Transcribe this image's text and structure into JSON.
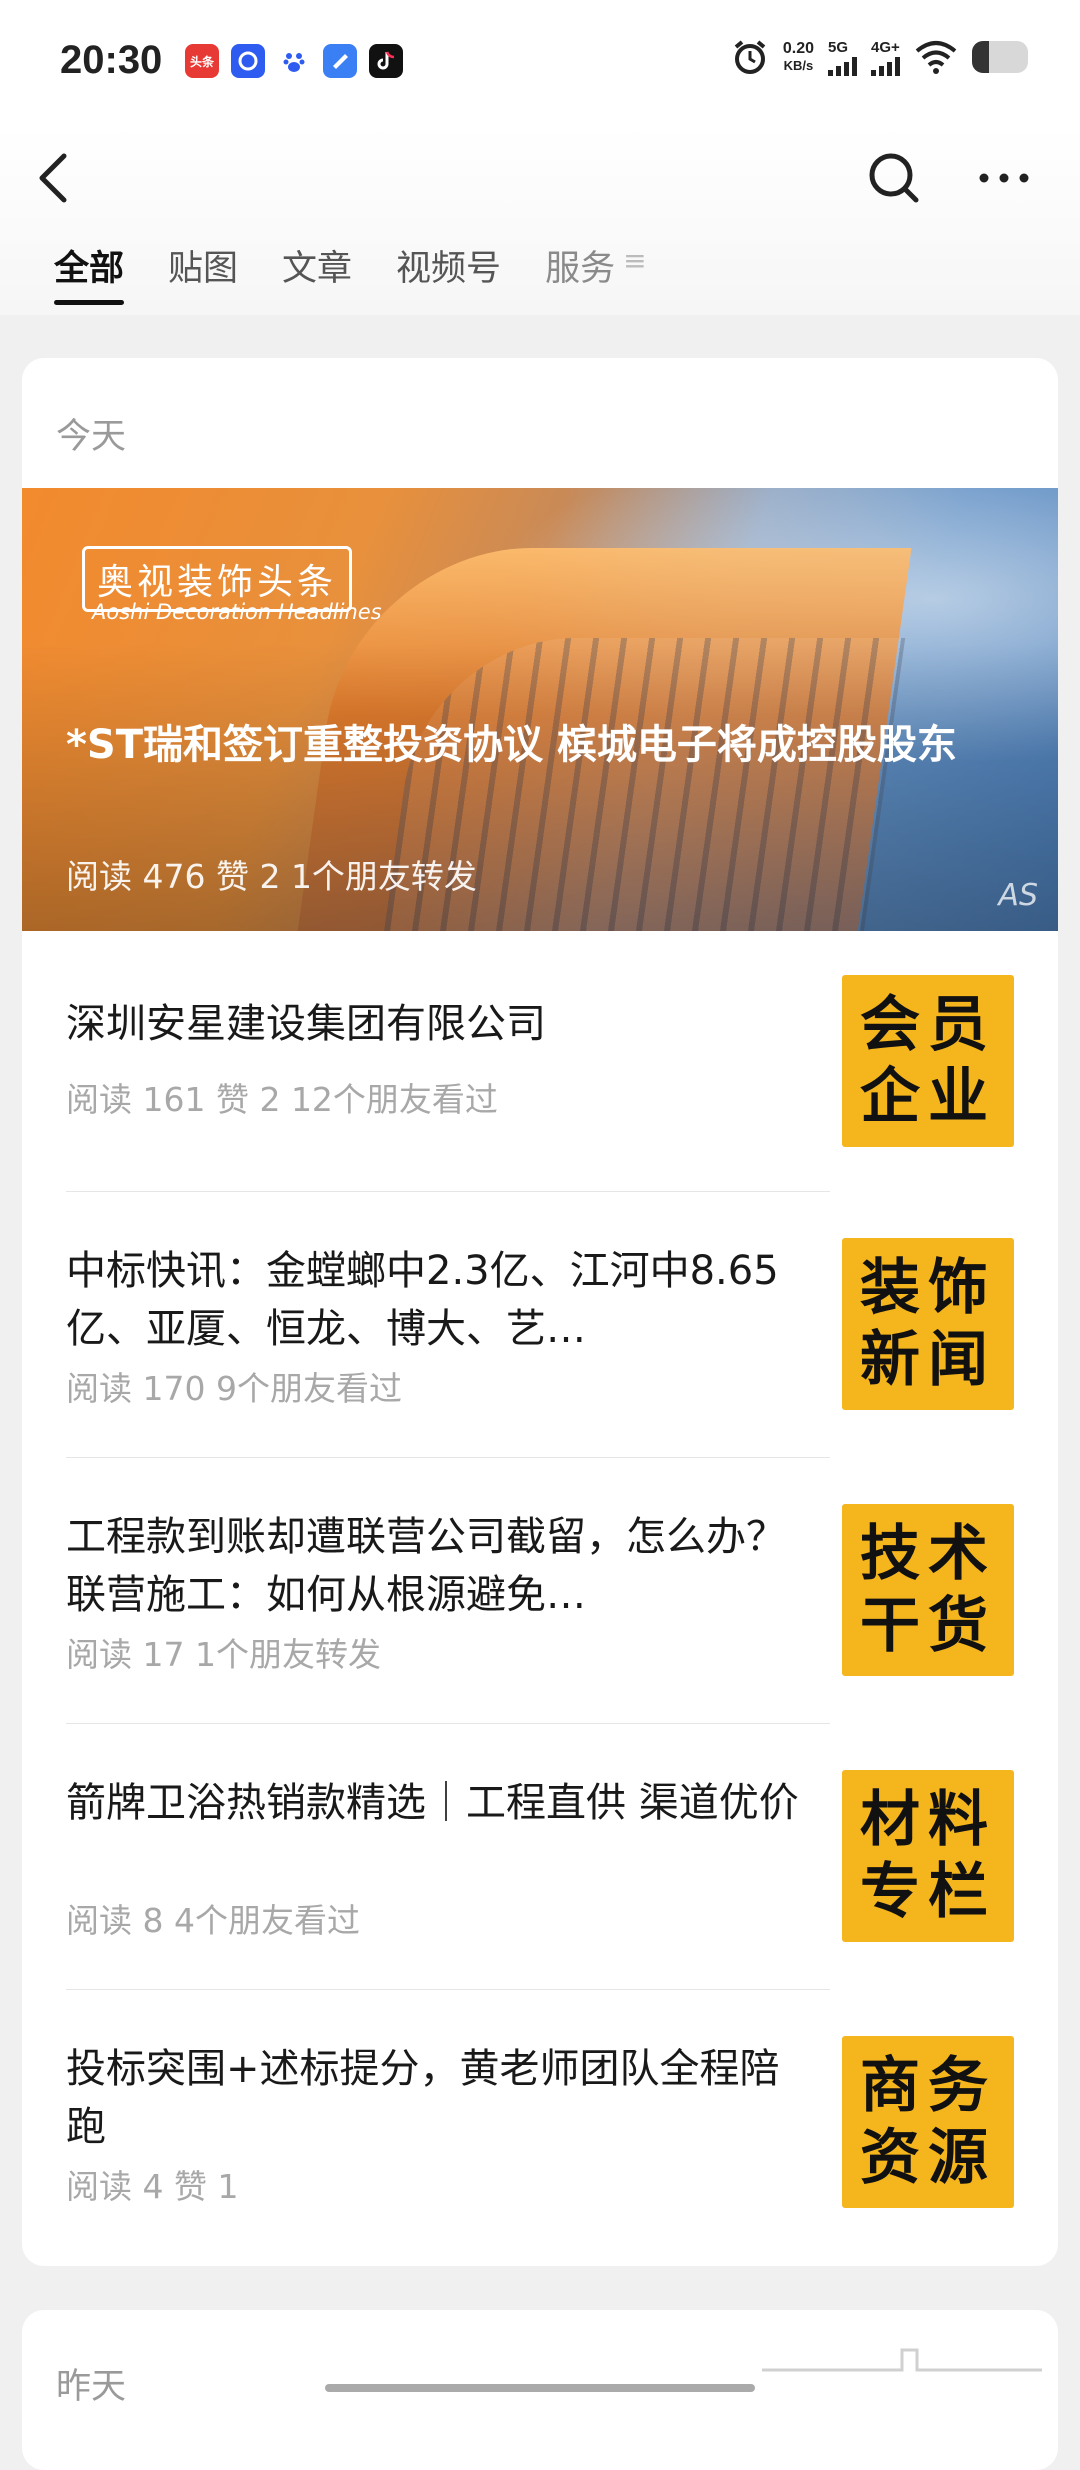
{
  "status_bar": {
    "time": "20:30",
    "app_icons": [
      {
        "name": "toutiao-app-icon",
        "text": "头条",
        "color": "#e83a35"
      },
      {
        "name": "baidu-paw-app-icon",
        "text": "",
        "color": "#2f5cf0"
      },
      {
        "name": "baidu-app-icon",
        "text": "",
        "color": "#ffffff"
      },
      {
        "name": "notes-app-icon",
        "text": "",
        "color": "#3b7ff5"
      },
      {
        "name": "tiktok-app-icon",
        "text": "",
        "color": "#111111"
      }
    ],
    "net_speed_value": "0.20",
    "net_speed_unit": "KB/s",
    "signal1_label": "5G",
    "signal2_label": "4G+",
    "battery_level": 0.3
  },
  "header": {
    "tabs": [
      {
        "label": "全部",
        "active": true
      },
      {
        "label": "贴图",
        "active": false
      },
      {
        "label": "文章",
        "active": false
      },
      {
        "label": "视频号",
        "active": false
      },
      {
        "label": "服务",
        "active": false
      }
    ],
    "tab_more": "≡"
  },
  "today_section": {
    "date_label": "今天",
    "banner": {
      "brand_cn": "奥视装饰头条",
      "brand_en": "Aoshi Decoration Headlines",
      "title": "*ST瑞和签订重整投资协议 槟城电子将成控股股东",
      "meta": "阅读 476   赞 2   1个朋友转发",
      "watermark": "AS"
    },
    "articles": [
      {
        "title": "深圳安星建设集团有限公司",
        "meta": "阅读 161   赞 2   12个朋友看过",
        "thumb_lines": [
          "会员",
          "企业"
        ]
      },
      {
        "title": "中标快讯：金螳螂中2.3亿、江河中8.65亿、亚厦、恒龙、博大、艺…",
        "meta": "阅读 170   9个朋友看过",
        "thumb_lines": [
          "装饰",
          "新闻"
        ]
      },
      {
        "title": "工程款到账却遭联营公司截留，怎么办？联营施工：如何从根源避免…",
        "meta": "阅读 17   1个朋友转发",
        "thumb_lines": [
          "技术",
          "干货"
        ]
      },
      {
        "title": "箭牌卫浴热销款精选｜工程直供 渠道优价",
        "meta": "阅读 8   4个朋友看过",
        "thumb_lines": [
          "材料",
          "专栏"
        ]
      },
      {
        "title": "投标突围+述标提分，黄老师团队全程陪跑",
        "meta": "阅读 4   赞 1",
        "thumb_lines": [
          "商务",
          "资源"
        ]
      }
    ]
  },
  "yesterday_section": {
    "date_label": "昨天"
  }
}
